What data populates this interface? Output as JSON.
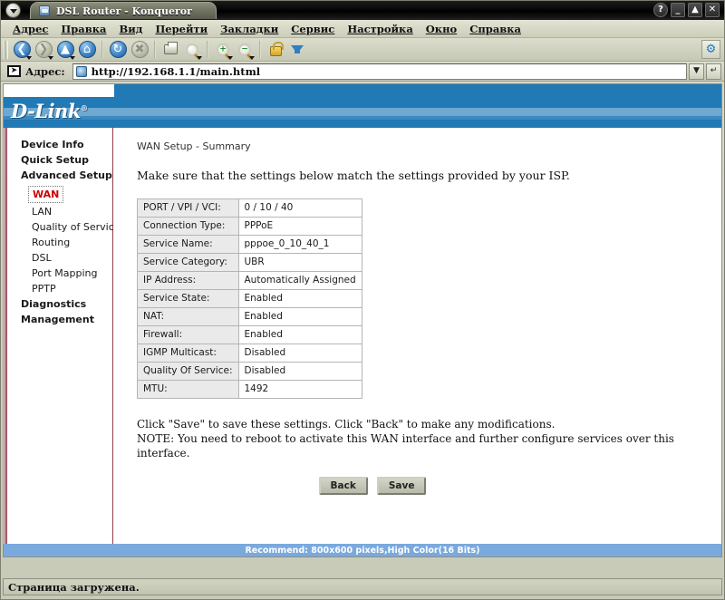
{
  "window": {
    "title": "DSL Router - Konqueror",
    "controls": [
      {
        "name": "help-button",
        "glyph": "?"
      },
      {
        "name": "minimize-button",
        "glyph": "_"
      },
      {
        "name": "maximize-button",
        "glyph": "▲"
      },
      {
        "name": "close-button",
        "glyph": "✕"
      }
    ]
  },
  "menubar": {
    "items": [
      {
        "accel": "А",
        "rest": "дрес"
      },
      {
        "accel": "П",
        "rest": "равка"
      },
      {
        "accel": "В",
        "rest": "ид"
      },
      {
        "accel": "П",
        "rest": "ерейти",
        "pre": ""
      },
      {
        "accel": "З",
        "rest": "акладки"
      },
      {
        "accel": "С",
        "rest": "ервис"
      },
      {
        "accel": "Н",
        "rest": "астройка"
      },
      {
        "accel": "О",
        "rest": "кно"
      },
      {
        "accel": "С",
        "rest": "правка"
      }
    ],
    "labels": [
      "Адрес",
      "Правка",
      "Вид",
      "Перейти",
      "Закладки",
      "Сервис",
      "Настройка",
      "Окно",
      "Справка"
    ]
  },
  "toolbar": {
    "icons": [
      "back-icon",
      "forward-icon",
      "up-icon",
      "home-icon",
      "reload-icon",
      "stop-icon",
      "print-icon",
      "find-icon",
      "zoom-in-icon",
      "zoom-out-icon",
      "lock-icon",
      "download-icon"
    ],
    "config_icon": "gear-icon"
  },
  "addressbar": {
    "label": "Адрес:",
    "url": "http://192.168.1.1/main.html",
    "dropdown_icon": "chevron-down-icon",
    "clear_icon": "clear-icon"
  },
  "page": {
    "brand": "D-Link",
    "brand_mark": "®",
    "sidebar": [
      {
        "label": "Device Info",
        "level": 0,
        "active": false
      },
      {
        "label": "Quick Setup",
        "level": 0,
        "active": false
      },
      {
        "label": "Advanced Setup",
        "level": 0,
        "active": false
      },
      {
        "label": "WAN",
        "level": 1,
        "active": true
      },
      {
        "label": "LAN",
        "level": 1,
        "active": false
      },
      {
        "label": "Quality of Service",
        "level": 1,
        "active": false
      },
      {
        "label": "Routing",
        "level": 1,
        "active": false
      },
      {
        "label": "DSL",
        "level": 1,
        "active": false
      },
      {
        "label": "Port Mapping",
        "level": 1,
        "active": false
      },
      {
        "label": "PPTP",
        "level": 1,
        "active": false
      },
      {
        "label": "Diagnostics",
        "level": 0,
        "active": false
      },
      {
        "label": "Management",
        "level": 0,
        "active": false
      }
    ],
    "title": "WAN Setup - Summary",
    "intro": "Make sure that the settings below match the settings provided by your ISP.",
    "table": [
      {
        "key": "PORT / VPI / VCI:",
        "value": "0 / 10 / 40"
      },
      {
        "key": "Connection Type:",
        "value": "PPPoE"
      },
      {
        "key": "Service Name:",
        "value": "pppoe_0_10_40_1"
      },
      {
        "key": "Service Category:",
        "value": "UBR"
      },
      {
        "key": "IP Address:",
        "value": "Automatically Assigned"
      },
      {
        "key": "Service State:",
        "value": "Enabled"
      },
      {
        "key": "NAT:",
        "value": "Enabled"
      },
      {
        "key": "Firewall:",
        "value": "Enabled"
      },
      {
        "key": "IGMP Multicast:",
        "value": "Disabled"
      },
      {
        "key": "Quality Of Service:",
        "value": "Disabled"
      },
      {
        "key": "MTU:",
        "value": "1492"
      }
    ],
    "note_line1": "Click \"Save\" to save these settings. Click \"Back\" to make any modifications.",
    "note_line2": "NOTE: You need to reboot to activate this WAN interface and further configure services over this interface.",
    "back_button": "Back",
    "save_button": "Save",
    "recommend": "Recommend: 800x600 pixels,High Color(16 Bits)"
  },
  "statusbar": {
    "text": "Страница загружена."
  },
  "colors": {
    "banner_blue": "#2179b5",
    "stripe_blue": "#6fa8d0",
    "recommend_blue": "#7aa9dd",
    "active_nav_red": "#cc0000",
    "divider_maroon": "#8d3d4b"
  }
}
